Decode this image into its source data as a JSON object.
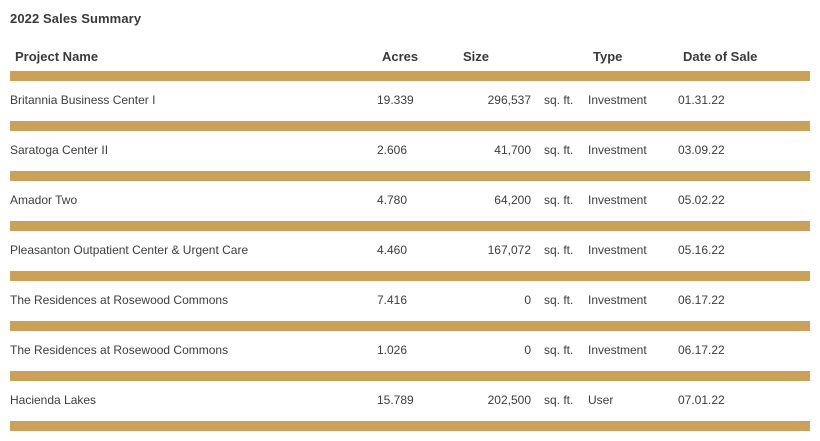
{
  "title": "2022 Sales Summary",
  "columns": {
    "name": "Project Name",
    "acres": "Acres",
    "size": "Size",
    "type": "Type",
    "date": "Date of Sale"
  },
  "rows": [
    {
      "name": "Britannia Business Center I",
      "acres": "19.339",
      "size": "296,537",
      "unit": "sq. ft.",
      "type": "Investment",
      "date": "01.31.22"
    },
    {
      "name": "Saratoga Center II",
      "acres": "2.606",
      "size": "41,700",
      "unit": "sq. ft.",
      "type": "Investment",
      "date": "03.09.22"
    },
    {
      "name": "Amador Two",
      "acres": "4.780",
      "size": "64,200",
      "unit": "sq. ft.",
      "type": "Investment",
      "date": "05.02.22"
    },
    {
      "name": "Pleasanton Outpatient Center & Urgent Care",
      "acres": "4.460",
      "size": "167,072",
      "unit": "sq. ft.",
      "type": "Investment",
      "date": "05.16.22"
    },
    {
      "name": "The Residences at Rosewood Commons",
      "acres": "7.416",
      "size": "0",
      "unit": "sq. ft.",
      "type": "Investment",
      "date": "06.17.22"
    },
    {
      "name": "The Residences at Rosewood Commons",
      "acres": "1.026",
      "size": "0",
      "unit": "sq. ft.",
      "type": "Investment",
      "date": "06.17.22"
    },
    {
      "name": "Hacienda Lakes",
      "acres": "15.789",
      "size": "202,500",
      "unit": "sq. ft.",
      "type": "User",
      "date": "07.01.22"
    }
  ],
  "colors": {
    "accent": "#cba15a",
    "text": "#3d3d3d"
  }
}
